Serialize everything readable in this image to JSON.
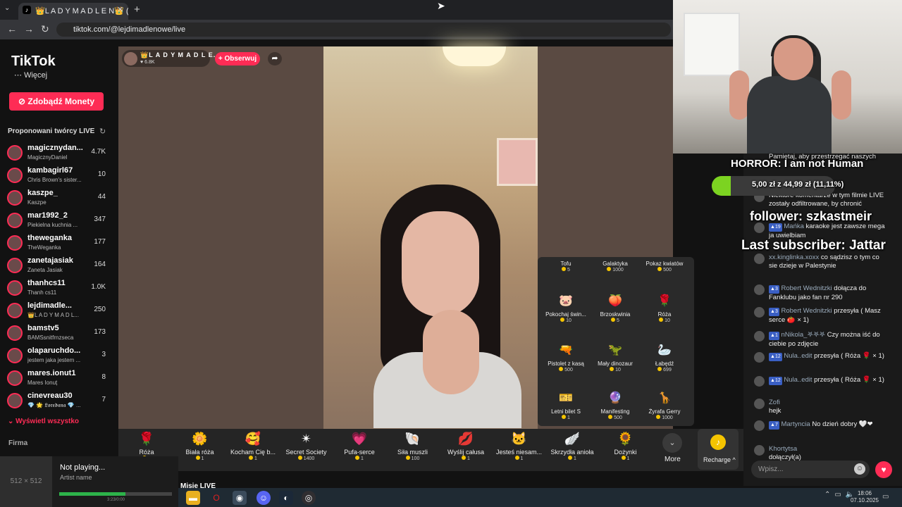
{
  "browser": {
    "tab_title": "👑L A D Y M A D L E N👑 (@le",
    "url": "tiktok.com/@lejdimadlenowe/live",
    "new_tab": "+",
    "close": "✕"
  },
  "sidebar": {
    "logo": "TikTok",
    "more_label": "Więcej",
    "coins_button": "Zdobądź Monety",
    "suggested_title": "Proponowani twórcy LIVE",
    "creators": [
      {
        "name": "magicznydan...",
        "sub": "MagicznyDaniel",
        "count": "4.7K"
      },
      {
        "name": "kambagirl67",
        "sub": "Chris Brown's sister...",
        "count": "10"
      },
      {
        "name": "kaszpe_",
        "sub": "Kaszpe",
        "count": "44"
      },
      {
        "name": "mar1992_2",
        "sub": "Piekielna kuchnia ...",
        "count": "347"
      },
      {
        "name": "theweganka",
        "sub": "TheWeganka",
        "count": "177"
      },
      {
        "name": "zanetajasiak",
        "sub": "Zaneta Jasiak",
        "count": "164"
      },
      {
        "name": "thanhcs11",
        "sub": "Thanh cs11",
        "count": "1.0K"
      },
      {
        "name": "lejdimadle...",
        "sub": "👑L A D Y M A D L...",
        "count": "250"
      },
      {
        "name": "bamstv5",
        "sub": "BAMSsnitfrnzseca",
        "count": "173"
      },
      {
        "name": "olaparuchdo...",
        "sub": "jestem jaka jestem ...",
        "count": "3"
      },
      {
        "name": "mares.ionut1",
        "sub": "Mares Ionuț",
        "count": "8"
      },
      {
        "name": "cinevreau30",
        "sub": "💎 🌟 𝕷𝖔𝖗𝖊𝖉𝖆𝖓𝖆 💎 ...",
        "count": "7"
      }
    ],
    "show_all": "Wyświetl wszystko",
    "firma": "Firma"
  },
  "stream": {
    "host_name": "👑L A D Y M A D L E...",
    "host_likes": "♥ 6.8K",
    "follow_button": "+ Obserwuj"
  },
  "gift_panel": [
    {
      "name": "Tofu",
      "price": "5",
      "icon": "🍮"
    },
    {
      "name": "Galaktyka",
      "price": "1000",
      "icon": "🌌"
    },
    {
      "name": "Pokaz kwiatów",
      "price": "500",
      "icon": "💐"
    },
    {
      "name": "Pokochaj świn...",
      "price": "10",
      "icon": "🐷"
    },
    {
      "name": "Brzoskwinia",
      "price": "5",
      "icon": "🍑"
    },
    {
      "name": "Róża",
      "price": "10",
      "icon": "🌹"
    },
    {
      "name": "Pistolet z kasą",
      "price": "500",
      "icon": "🔫"
    },
    {
      "name": "Mały dinozaur",
      "price": "10",
      "icon": "🦖"
    },
    {
      "name": "Łabędź",
      "price": "699",
      "icon": "🦢"
    },
    {
      "name": "Letni bilet S",
      "price": "1",
      "icon": "🎫"
    },
    {
      "name": "Manifesting",
      "price": "500",
      "icon": "🔮"
    },
    {
      "name": "Żyrafa Gerry",
      "price": "1000",
      "icon": "🦒"
    }
  ],
  "gift_bar": [
    {
      "name": "Róża",
      "price": "1",
      "icon": "🌹"
    },
    {
      "name": "Biała róża",
      "price": "1",
      "icon": "🌼"
    },
    {
      "name": "Kocham Cię b...",
      "price": "1",
      "icon": "🥰"
    },
    {
      "name": "Secret Society",
      "price": "1400",
      "icon": "✴"
    },
    {
      "name": "Pufa-serce",
      "price": "1",
      "icon": "💗"
    },
    {
      "name": "Siła muszli",
      "price": "100",
      "icon": "🐚"
    },
    {
      "name": "Wyślij całusa",
      "price": "1",
      "icon": "💋"
    },
    {
      "name": "Jesteś niesam...",
      "price": "1",
      "icon": "🐱"
    },
    {
      "name": "Skrzydła anioła",
      "price": "1",
      "icon": "🪽"
    },
    {
      "name": "Dożynki",
      "price": "1",
      "icon": "🌻"
    }
  ],
  "more_label": "More",
  "recharge_label": "Recharge ^",
  "overlay": {
    "notice": "Pamiętaj, aby przestrzegać naszych",
    "horror": "HORROR: I am not Human",
    "goal": "5,00 zł z 44,99 zł (11,11%)",
    "follower": "follower: szkastmeir",
    "subscriber": "Last subscriber: Jattar"
  },
  "goal_fraction": 0.1111,
  "chat": [
    {
      "text": "Niektóre komentarze w tym filmie LIVE zostały odfiltrowane, by chronić"
    },
    {
      "level": "19",
      "user": "Mańka",
      "text": "karaoke jest zawsze mega ja uwielbiam"
    },
    {
      "user": "xx.kinglinka.xoxx",
      "text": "co sądzisz o tym co sie dzieje w Palestynie"
    },
    {
      "level": "3",
      "user": "Robert Wednitzki",
      "text": "dołącza do Fanklubu jako fan nr 290"
    },
    {
      "level": "3",
      "user": "Robert Wednitzki",
      "text": "przesyła ( Masz serce 🍅 × 1)"
    },
    {
      "level": "1",
      "user": "nNikola_𖤐𖤐𖤐",
      "text": "Czy można iść do ciebie po zdjęcie"
    },
    {
      "level": "12",
      "user": "Nula..edit",
      "text": "przesyła ( Róża 🌹 × 1)"
    },
    {
      "level": "12",
      "user": "Nula..edit",
      "text": "przesyła ( Róża 🌹 × 1)"
    },
    {
      "user": "Zofi",
      "text": "hejk"
    },
    {
      "level": "7",
      "user": "Martyncia",
      "text": "No dzień dobry 🤍❤"
    },
    {
      "user": "Khortytsa",
      "text": "dołączył(a)"
    }
  ],
  "chat_input_placeholder": "Wpisz...",
  "media": {
    "art_size": "512 × 512",
    "title": "Not playing...",
    "artist": "Artist name",
    "time": "3:23/0:00",
    "progress": 0.59
  },
  "misje_label": "Misje LIVE",
  "clock": {
    "time": "18:06",
    "date": "07.10.2025"
  }
}
